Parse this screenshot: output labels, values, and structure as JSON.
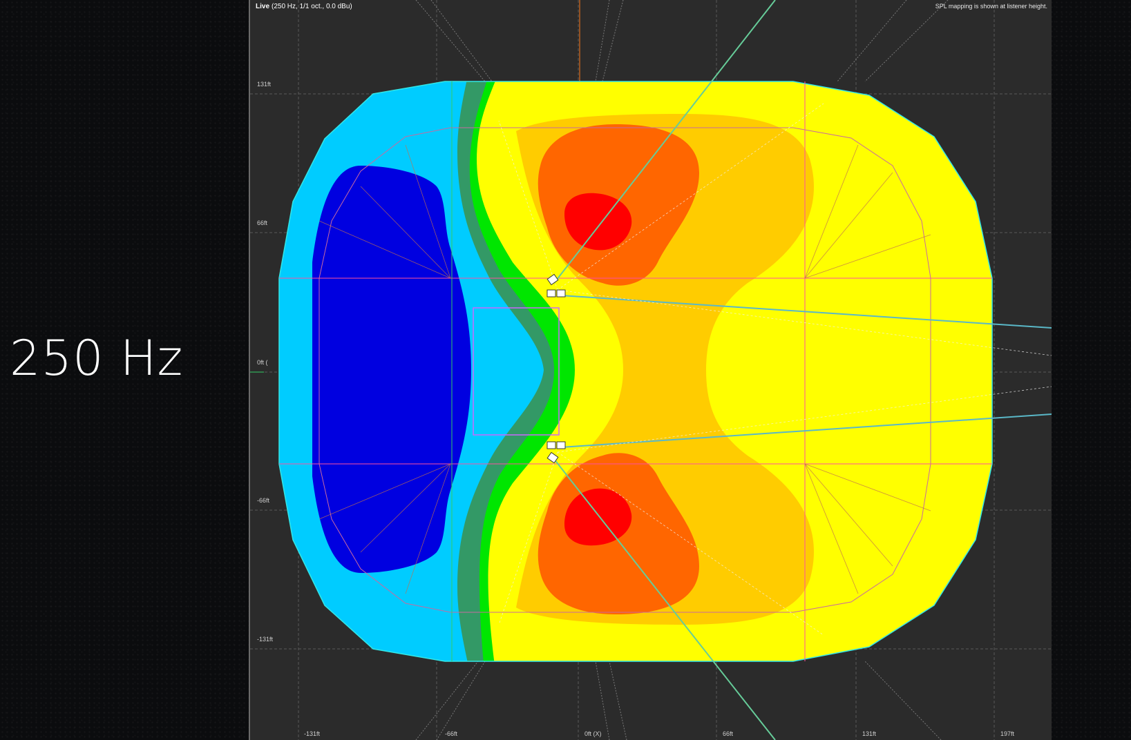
{
  "overlay": {
    "frequency_label": "250 Hz"
  },
  "header": {
    "mode": "Live",
    "settings": "(250 Hz, 1/1 oct., 0.0 dBu)",
    "note": "SPL mapping is shown at listener height."
  },
  "axes": {
    "x_ticks": [
      "-131ft",
      "-66ft",
      "0ft (X)",
      "66ft",
      "131ft",
      "197ft"
    ],
    "y_ticks": [
      "131ft",
      "66ft",
      "0ft (",
      "-66ft",
      "-131ft"
    ]
  },
  "colors": {
    "background": "#0b0c0e",
    "panel": "#2b2b2b",
    "spl_red": "#ff0000",
    "spl_dark_orange": "#ff6600",
    "spl_orange": "#ffcc00",
    "spl_yellow": "#ffff00",
    "spl_green": "#00e600",
    "spl_sea_green": "#339966",
    "spl_cyan": "#00ccff",
    "spl_blue": "#0000e0",
    "outline_cyan": "#33e6e6",
    "surface_lines": "#ff4fa0",
    "stage_magenta": "#cc66ff"
  },
  "speakers": [
    {
      "name": "speaker-array-top-icon"
    },
    {
      "name": "speaker-array-bottom-icon"
    }
  ]
}
